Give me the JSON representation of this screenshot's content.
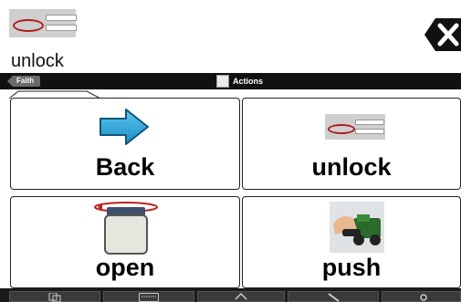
{
  "message_bar": {
    "text": "unlock",
    "clear_icon": "clear-x-icon"
  },
  "navbar": {
    "back_label": "Faith",
    "title": "Actions"
  },
  "buttons": [
    {
      "label": "Back",
      "icon": "back-arrow-icon"
    },
    {
      "label": "unlock",
      "icon": "password-field-icon"
    },
    {
      "label": "open",
      "icon": "jar-icon"
    },
    {
      "label": "push",
      "icon": "hand-pushing-toy-icon"
    }
  ],
  "toolbar": {
    "icons": [
      "copy-icon",
      "keyboard-icon",
      "home-icon",
      "clear-icon",
      "settings-icon"
    ]
  }
}
